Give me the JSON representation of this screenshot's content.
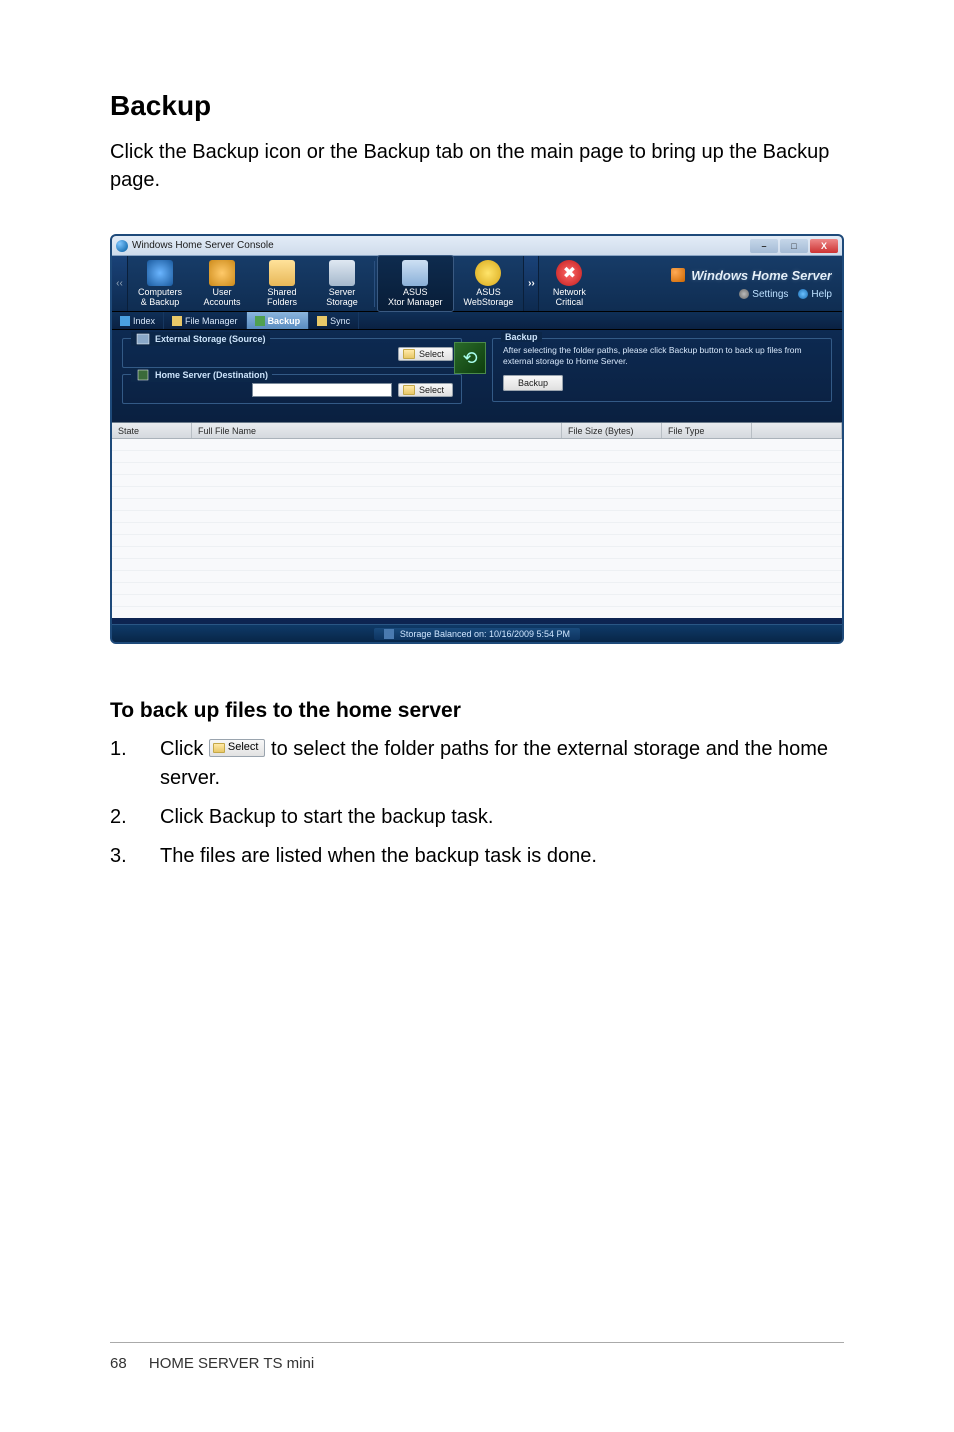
{
  "section": {
    "title": "Backup"
  },
  "intro": "Click the Backup icon or the Backup tab on the main page to bring up the Backup page.",
  "screenshot": {
    "window_title": "Windows Home Server Console",
    "toolbar": {
      "items": [
        {
          "label": "Computers\n& Backup"
        },
        {
          "label": "User\nAccounts"
        },
        {
          "label": "Shared\nFolders"
        },
        {
          "label": "Server\nStorage"
        },
        {
          "label_top": "ASUS",
          "label": "Xtor Manager"
        },
        {
          "label_top": "ASUS",
          "label": "WebStorage"
        },
        {
          "label": "Network\nCritical"
        }
      ],
      "brand": "Windows Home Server",
      "settings": "Settings",
      "help": "Help"
    },
    "subtabs": {
      "items": [
        "Index",
        "File Manager",
        "Backup",
        "Sync"
      ],
      "active": "Backup"
    },
    "panels": {
      "src_label": "External Storage (Source)",
      "dst_label": "Home Server (Destination)",
      "select_label": "Select",
      "backup": {
        "title": "Backup",
        "desc": "After selecting the folder paths, please click Backup button to back up files from external storage to Home Server.",
        "button": "Backup"
      }
    },
    "table": {
      "cols": [
        "State",
        "Full File Name",
        "File Size (Bytes)",
        "File Type",
        ""
      ]
    },
    "status": "Storage Balanced on: 10/16/2009 5:54 PM"
  },
  "subsection": {
    "title": "To back up files to the home server"
  },
  "steps": {
    "s1a": "Click ",
    "s1b": " to select the folder paths for the external storage and the home server.",
    "s2": "Click Backup to start the backup task.",
    "s3": "The files are listed when the backup task is done.",
    "inline_select": "Select"
  },
  "footer": {
    "page": "68",
    "product": "HOME SERVER TS mini"
  }
}
